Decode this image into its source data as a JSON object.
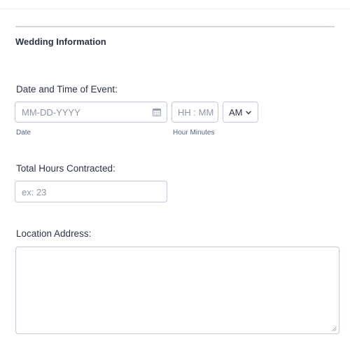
{
  "section": {
    "title": "Wedding Information"
  },
  "event_date_time": {
    "label": "Date and Time of Event:",
    "date": {
      "placeholder": "MM-DD-YYYY",
      "value": "",
      "sublabel": "Date",
      "icon": "calendar-icon"
    },
    "time": {
      "placeholder": "HH : MM",
      "value": "",
      "sublabel": "Hour Minutes"
    },
    "ampm": {
      "selected": "AM",
      "icon": "chevron-down-icon"
    }
  },
  "hours_contracted": {
    "label": "Total Hours Contracted:",
    "placeholder": "ex: 23",
    "value": ""
  },
  "location_address": {
    "label": "Location Address:",
    "value": ""
  },
  "colors": {
    "text": "#2c3345",
    "sublabel": "#57647e",
    "border": "#c3cad8",
    "placeholder": "#8f96a3",
    "divider": "#d4d6de"
  }
}
